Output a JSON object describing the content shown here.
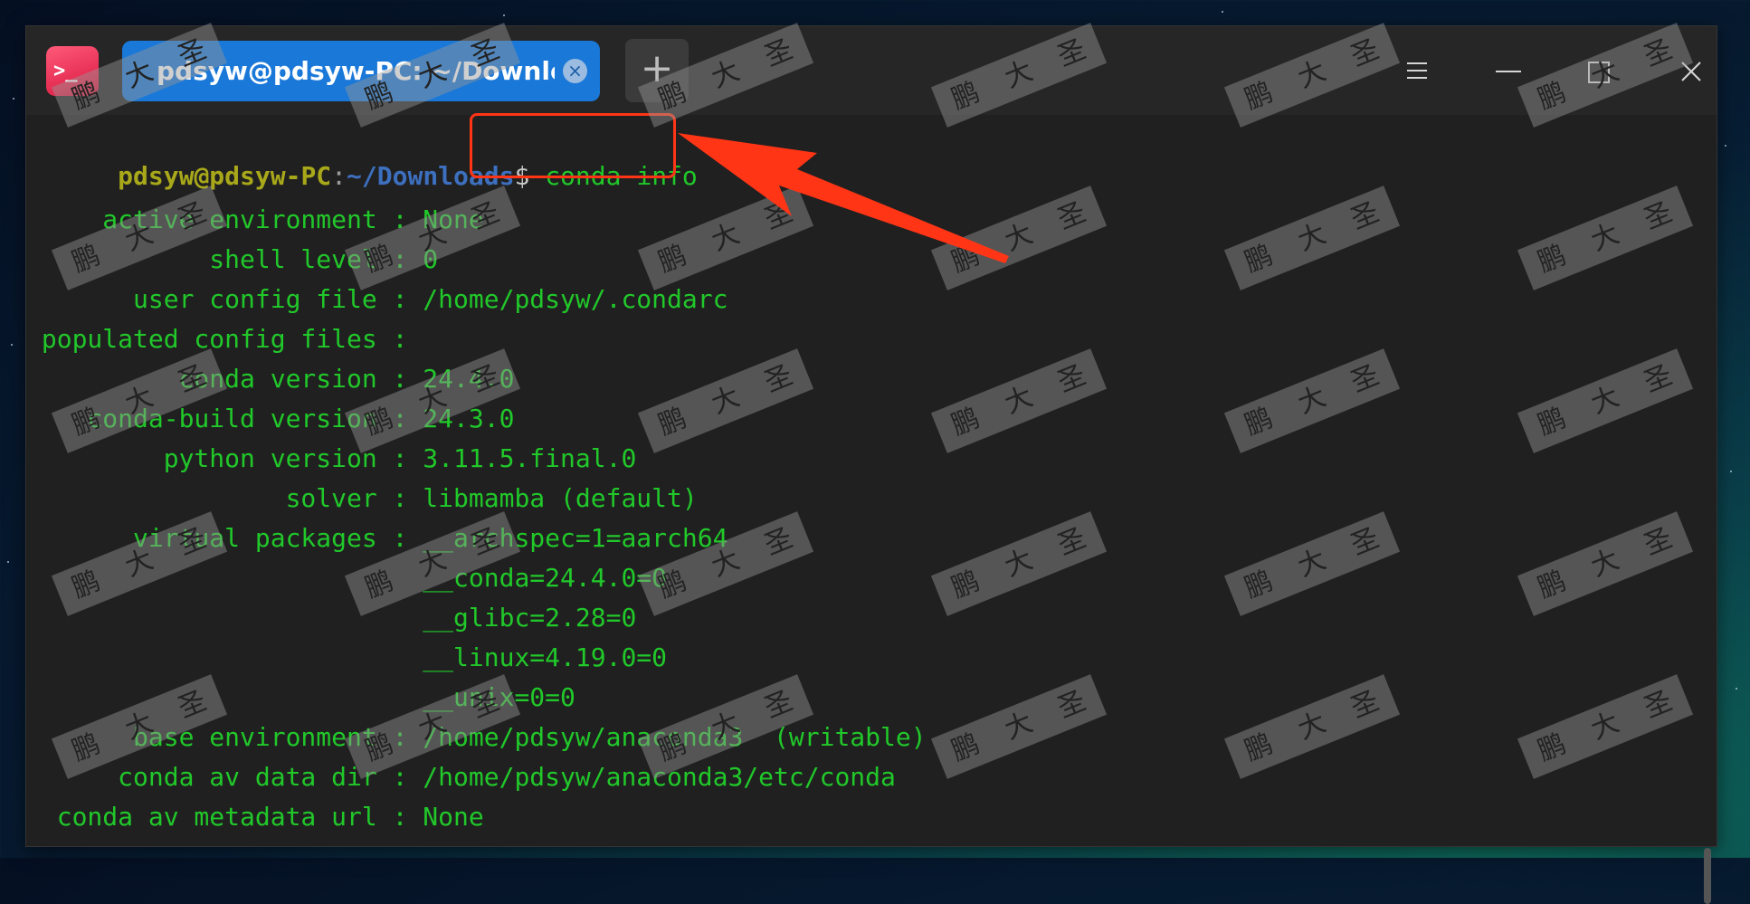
{
  "window": {
    "app_icon_glyph": ">_",
    "tab_title": "pdsyw@pdsyw-PC: ~/Downloads",
    "tab_close_glyph": "×",
    "new_tab_glyph": "+",
    "controls": [
      "menu-icon",
      "minimize-icon",
      "maximize-icon",
      "close-icon"
    ]
  },
  "terminal": {
    "prompt": {
      "user_host": "pdsyw@pdsyw-PC",
      "colon": ":",
      "path": "~/Downloads",
      "dollar": "$ ",
      "command": "conda info"
    },
    "lines": [
      "     active environment : None",
      "            shell level : 0",
      "       user config file : /home/pdsyw/.condarc",
      " populated config files : ",
      "          conda version : 24.4.0",
      "    conda-build version : 24.3.0",
      "         python version : 3.11.5.final.0",
      "                 solver : libmamba (default)",
      "       virtual packages : __archspec=1=aarch64",
      "                          __conda=24.4.0=0",
      "                          __glibc=2.28=0",
      "                          __linux=4.19.0=0",
      "                          __unix=0=0",
      "       base environment : /home/pdsyw/anaconda3  (writable)",
      "      conda av data dir : /home/pdsyw/anaconda3/etc/conda",
      "  conda av metadata url : None"
    ]
  },
  "annotation": {
    "highlight_color": "#ff3516"
  },
  "watermark": {
    "chars": [
      "鹏",
      "大",
      "圣"
    ]
  },
  "colors": {
    "output_text": "#21c82a",
    "prompt_user": "#a8a81a",
    "prompt_path": "#3d6fbf",
    "tab_active": "#1a78d8"
  }
}
